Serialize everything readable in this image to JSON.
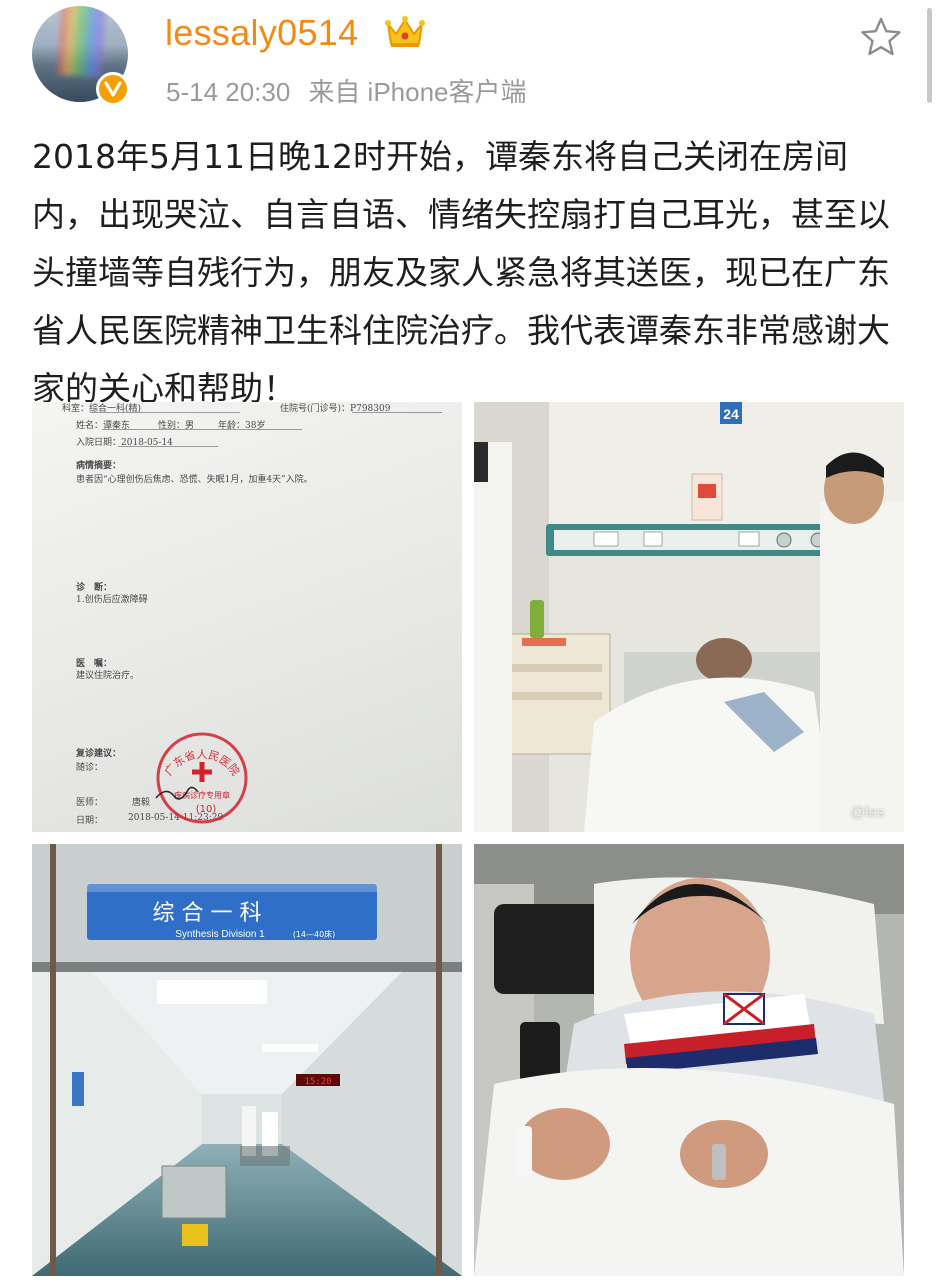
{
  "header": {
    "username": "lessaly0514",
    "timestamp": "5-14 20:30",
    "source": "来自 iPhone客户端",
    "badge_icon": "verified-v-icon",
    "crown_icon": "crown-icon",
    "favorite_icon": "star-outline-icon"
  },
  "post": {
    "text": "2018年5月11日晚12时开始，谭秦东将自己关闭在房间内，出现哭泣、自言自语、情绪失控扇打自己耳光，甚至以头撞墙等自残行为，朋友及家人紧急将其送医，现已在广东省人民医院精神卫生科住院治疗。我代表谭秦东非常感谢大家的关心和帮助！"
  },
  "photos": {
    "document": {
      "dept_label": "科室：",
      "dept_value": "综合一科(精)",
      "inpatient_label": "住院号(门诊号)：",
      "inpatient_value": "P798309",
      "name_label": "姓名：",
      "name_value": "谭秦东",
      "sex_label": "性别：",
      "sex_value": "男",
      "age_label": "年龄：",
      "age_value": "38岁",
      "admit_label": "入院日期：",
      "admit_value": "2018-05-14",
      "summary_title": "病情摘要：",
      "summary_text": "患者因“心理创伤后焦虑、恐慌、失眠1月，加重4天”入院。",
      "diagnosis_title": "诊　断：",
      "diagnosis_text": "1.创伤后应激障碍",
      "advice_title": "医　嘱：",
      "advice_text": "建议住院治疗。",
      "followup_title": "复诊建议：",
      "followup_text": "随诊：",
      "doctor_label": "医师：",
      "doctor_value": "唐毅",
      "date_label": "日期：",
      "date_value": "2018-05-14 11:23:29",
      "stamp_top": "广东省人民医院",
      "stamp_bottom": "疾病诊疗专用章",
      "stamp_number": "(10)"
    },
    "ward": {
      "room_number": "24",
      "watermark": "@les"
    },
    "corridor": {
      "sign_cn": "综 合 一 科",
      "sign_en": "Synthesis Division 1",
      "sign_beds": "(14—40床)",
      "clock": "15:20"
    },
    "patient": {}
  },
  "colors": {
    "username": "#f48a16",
    "meta": "#9a9a9a",
    "body_text": "#1e1e1e",
    "verified_badge": "#f5a000",
    "stamp_red": "#d2212a",
    "sign_blue": "#2f6fc7"
  }
}
